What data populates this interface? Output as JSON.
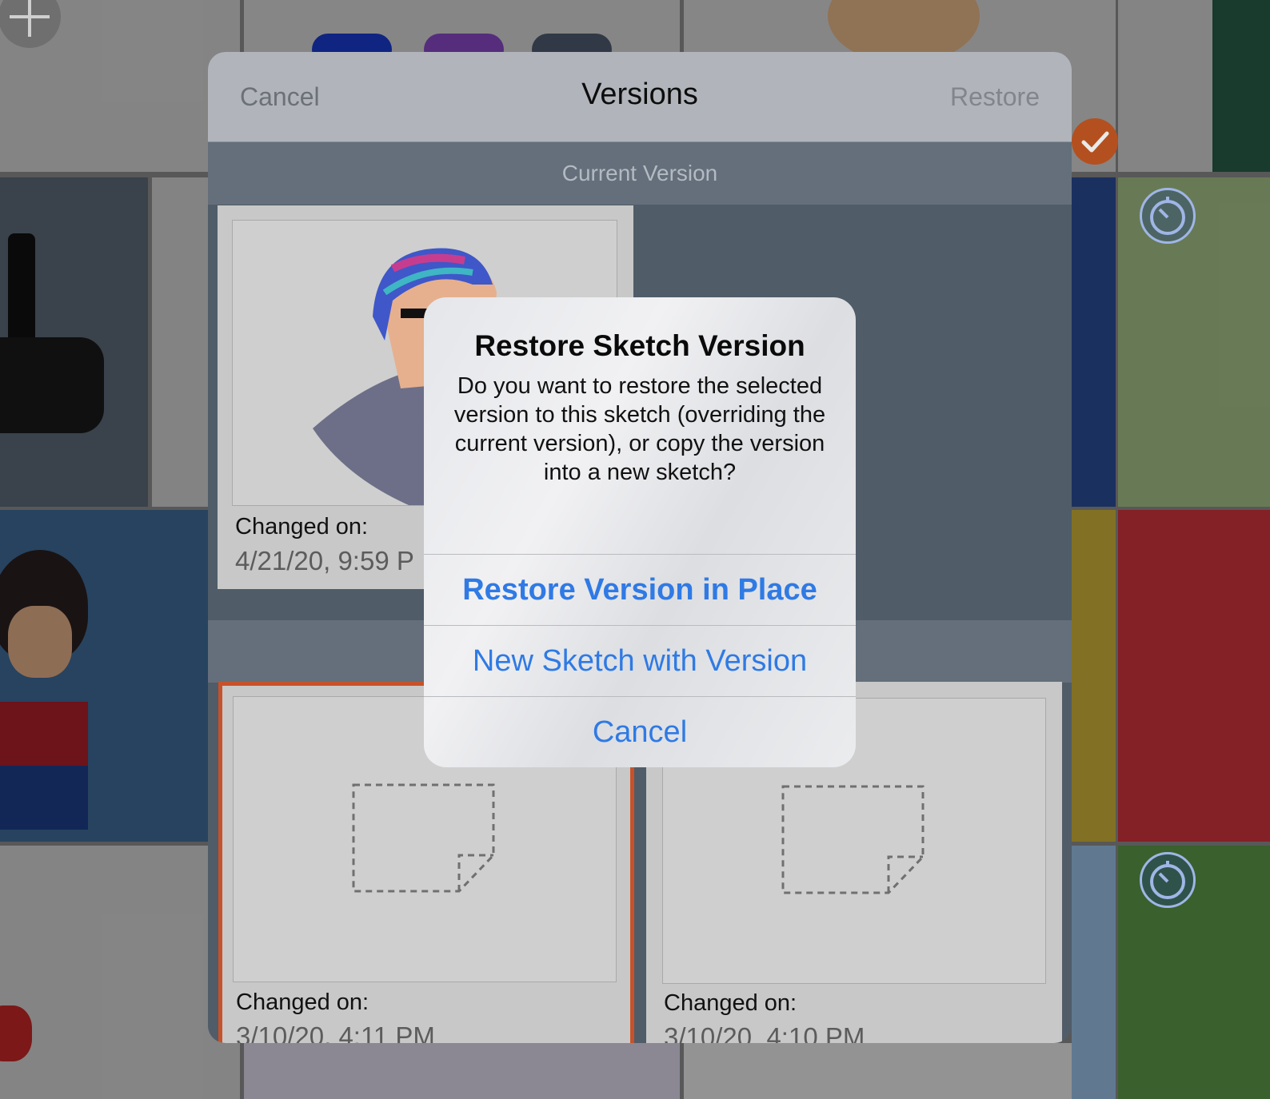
{
  "versions_sheet": {
    "cancel_label": "Cancel",
    "title": "Versions",
    "restore_label": "Restore",
    "current_section_label": "Current Version",
    "current_version": {
      "changed_label": "Changed on:",
      "date": "4/21/20, 9:59 P"
    },
    "older_versions": [
      {
        "changed_label": "Changed on:",
        "date": "3/10/20, 4:11 PM",
        "selected": true
      },
      {
        "changed_label": "Changed on:",
        "date": "3/10/20, 4:10 PM",
        "selected": false
      }
    ]
  },
  "alert": {
    "title": "Restore Sketch Version",
    "message": "Do you want to restore the selected version to this sketch (overriding the current version), or copy the version into a new sketch?",
    "restore_in_place_label": "Restore Version in Place",
    "new_sketch_label": "New Sketch with Version",
    "cancel_label": "Cancel"
  },
  "colors": {
    "accent_blue": "#2f7ae5",
    "selection_orange": "#c7522a",
    "check_badge": "#d35400"
  },
  "icons": [
    "add-icon",
    "checkmark-icon",
    "clock-icon",
    "blank-sketch-icon"
  ]
}
